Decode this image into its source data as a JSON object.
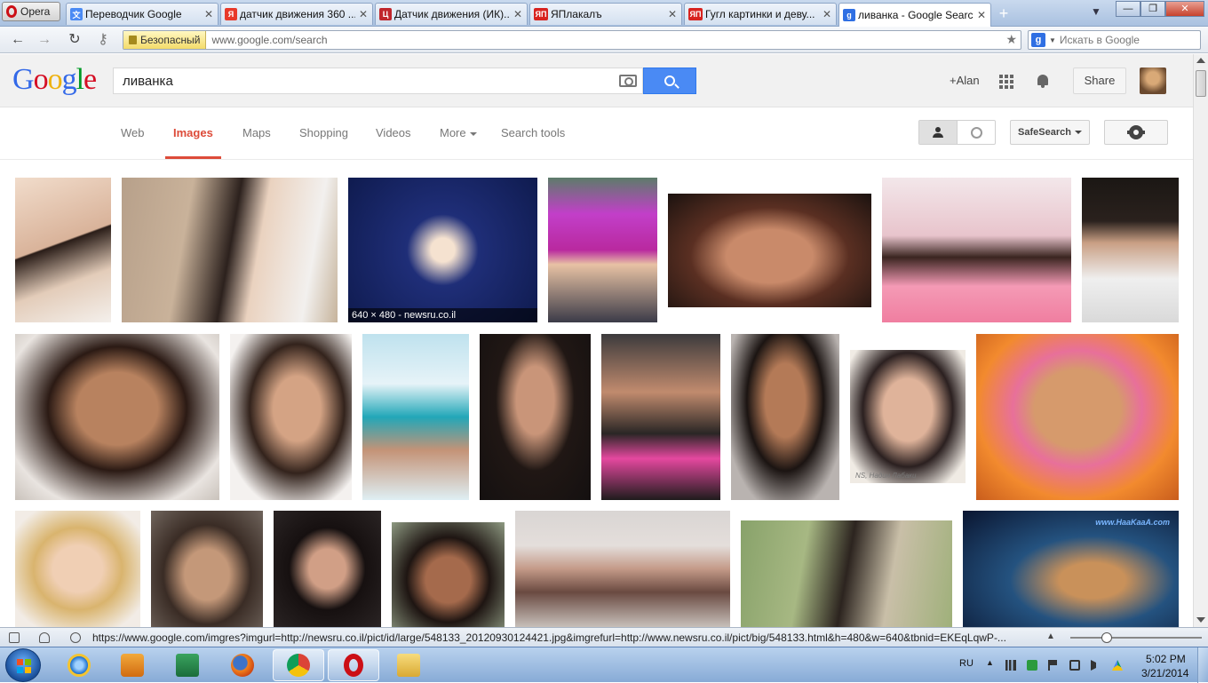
{
  "browser": {
    "menu_label": "Opera",
    "tabs": [
      {
        "title": "Переводчик Google",
        "favicon": "google-translate-icon",
        "color": "#4a8af4",
        "active": false
      },
      {
        "title": "датчик движения 360 ...",
        "favicon": "yandex-icon",
        "color": "#e8392a",
        "active": false
      },
      {
        "title": "Датчик движения (ИК)...",
        "favicon": "shop-icon",
        "color": "#c0262c",
        "active": false
      },
      {
        "title": "ЯПлакалъ",
        "favicon": "yaplakal-icon",
        "color": "#d8231f",
        "active": false
      },
      {
        "title": "Гугл картинки и деву...",
        "favicon": "yaplakal-icon",
        "color": "#d8231f",
        "active": false
      },
      {
        "title": "ливанка - Google Search",
        "favicon": "google-icon",
        "color": "#2f6fe3",
        "active": true
      }
    ],
    "tab_close_symbol": "✕",
    "new_tab_symbol": "+",
    "security_label": "Безопасный",
    "url_host": "www.google.com",
    "url_path": "/search",
    "search_placeholder": "Искать в Google"
  },
  "google": {
    "logo_text": "Google",
    "logo_colors": [
      "#3369e8",
      "#d50f25",
      "#eeb211",
      "#3369e8",
      "#009925",
      "#d50f25"
    ],
    "query": "ливанка",
    "user_label": "+Alan",
    "share_label": "Share",
    "nav_tabs": [
      {
        "label": "Web",
        "active": false
      },
      {
        "label": "Images",
        "active": true
      },
      {
        "label": "Maps",
        "active": false
      },
      {
        "label": "Shopping",
        "active": false
      },
      {
        "label": "Videos",
        "active": false
      },
      {
        "label": "More",
        "active": false,
        "dropdown": true
      },
      {
        "label": "Search tools",
        "active": false
      }
    ],
    "safesearch_label": "SafeSearch",
    "accent_color": "#dd4b39",
    "search_button_color": "#4a8af4"
  },
  "results": {
    "hover_caption": "640 × 480 - newsru.co.il",
    "thumb_watermark": "NS, Надин Лабаки",
    "video_watermark": "www.HaaKaaA.com"
  },
  "status": {
    "url": "https://www.google.com/imgres?imgurl=http://newsru.co.il/pict/id/large/548133_20120930124421.jpg&imgrefurl=http://www.newsru.co.il/pict/big/548133.html&h=480&w=640&tbnid=EKEqLqwP-..."
  },
  "taskbar": {
    "apps": [
      "internet-explorer-icon",
      "media-player-icon",
      "excel-icon",
      "firefox-icon",
      "chrome-icon",
      "opera-icon",
      "file-explorer-icon"
    ],
    "language": "RU",
    "time": "5:02 PM",
    "date": "3/21/2014"
  }
}
